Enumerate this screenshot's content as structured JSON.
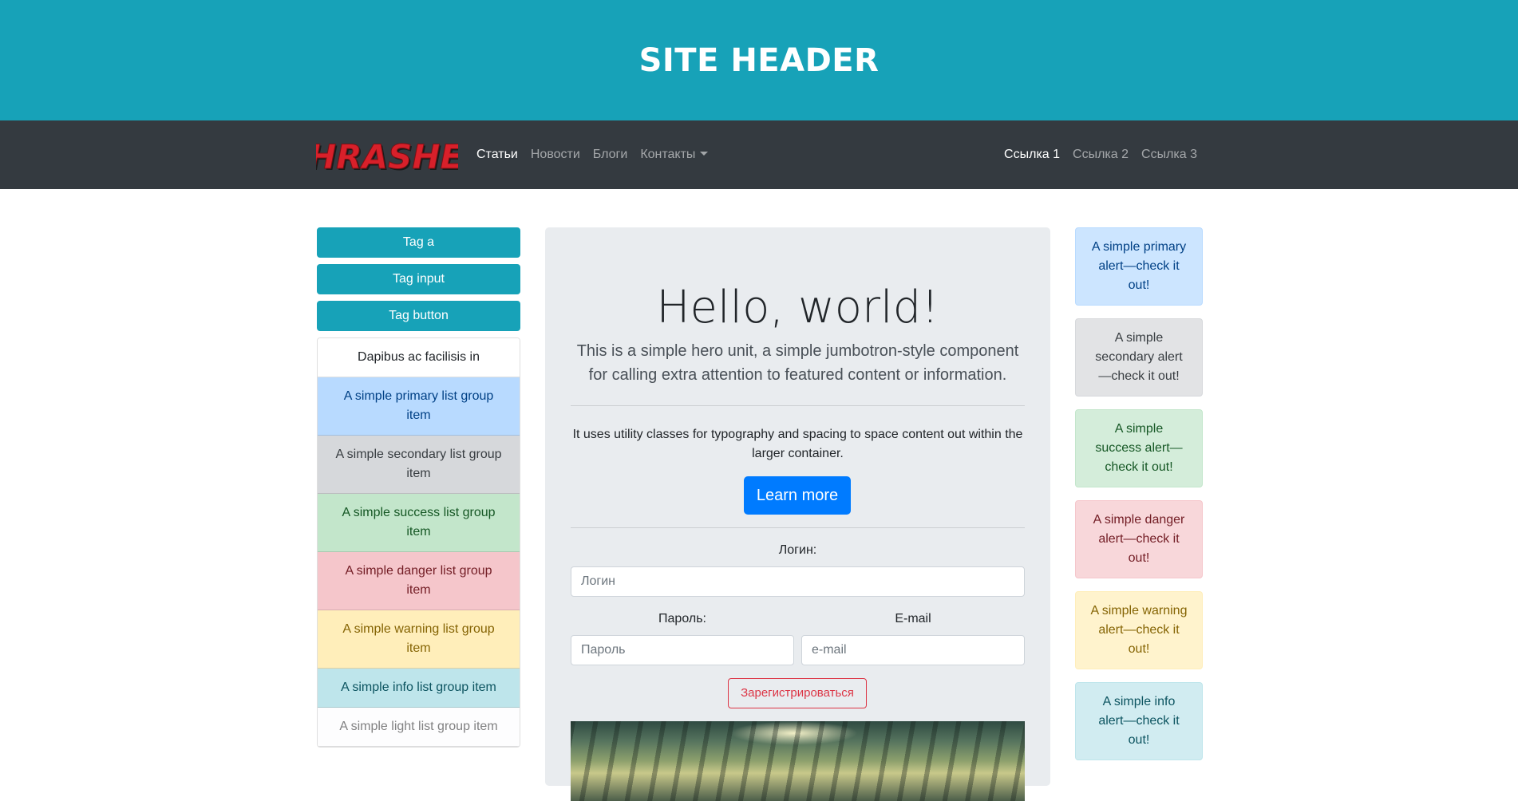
{
  "header": {
    "title": "SITE HEADER"
  },
  "navbar": {
    "logo_text": "THRASHER",
    "left_links": [
      "Статьи",
      "Новости",
      "Блоги",
      "Контакты"
    ],
    "right_links": [
      "Ссылка 1",
      "Ссылка 2",
      "Ссылка 3"
    ]
  },
  "left_col": {
    "buttons": [
      "Tag a",
      "Tag input",
      "Tag button"
    ],
    "list_items": [
      "Dapibus ac facilisis in",
      "A simple primary list group item",
      "A simple secondary list group item",
      "A simple success list group item",
      "A simple danger list group item",
      "A simple warning list group item",
      "A simple info list group item",
      "A simple light list group item"
    ]
  },
  "jumbotron": {
    "title": "Hello, world!",
    "lead": "This is a simple hero unit, a simple jumbotron-style component for calling extra attention to featured content or information.",
    "text": "It uses utility classes for typography and spacing to space content out within the larger container.",
    "button": "Learn more"
  },
  "form": {
    "login_label": "Логин:",
    "login_placeholder": "Логин",
    "password_label": "Пароль:",
    "password_placeholder": "Пароль",
    "email_label": "E-mail",
    "email_placeholder": "e-mail",
    "submit": "Зарегистрироваться"
  },
  "right_col": {
    "alerts": [
      "A simple primary alert—check it out!",
      "A simple secondary alert—check it out!",
      "A simple success alert—check it out!",
      "A simple danger alert—check it out!",
      "A simple warning alert—check it out!",
      "A simple info alert—check it out!"
    ]
  },
  "colors": {
    "header_bg": "#17a2b8",
    "navbar_bg": "#343a40",
    "primary": "#007bff",
    "danger": "#dc3545",
    "logo_red": "#d8202a"
  }
}
